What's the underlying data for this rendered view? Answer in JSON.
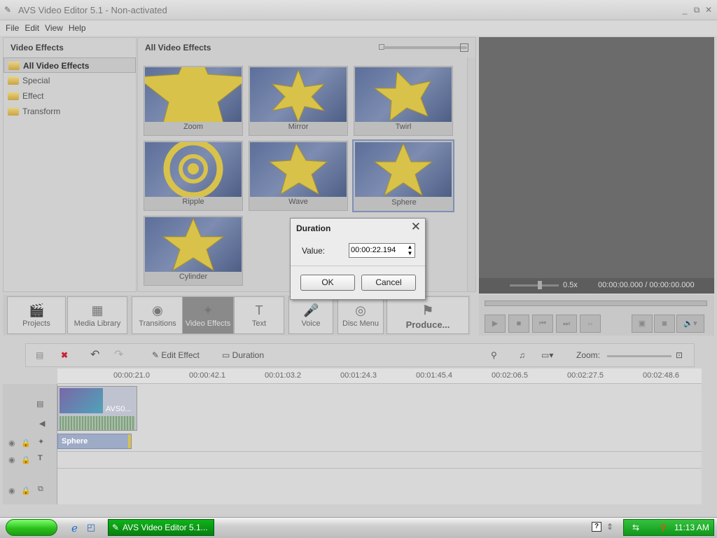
{
  "window": {
    "title": "AVS Video Editor 5.1 - Non-activated"
  },
  "menu": [
    "File",
    "Edit",
    "View",
    "Help"
  ],
  "sidebar": {
    "header": "Video Effects",
    "items": [
      {
        "label": "All Video Effects",
        "selected": true
      },
      {
        "label": "Special"
      },
      {
        "label": "Effect"
      },
      {
        "label": "Transform"
      }
    ]
  },
  "effects": {
    "header": "All Video Effects",
    "tiles": [
      {
        "label": "Zoom"
      },
      {
        "label": "Mirror"
      },
      {
        "label": "Twirl"
      },
      {
        "label": "Ripple"
      },
      {
        "label": "Wave"
      },
      {
        "label": "Sphere",
        "selected": true
      },
      {
        "label": "Cylinder"
      }
    ]
  },
  "preview": {
    "speed": "0.5x",
    "time": "00:00:00.000 / 00:00:00.000"
  },
  "tabs": [
    {
      "label": "Projects",
      "icon": "clapper-icon"
    },
    {
      "label": "Media Library",
      "icon": "film-icon"
    },
    {
      "label": "Transitions",
      "icon": "transition-icon"
    },
    {
      "label": "Video Effects",
      "icon": "star-wand-icon",
      "active": true
    },
    {
      "label": "Text",
      "icon": "text-t-icon"
    },
    {
      "label": "Voice",
      "icon": "microphone-icon"
    },
    {
      "label": "Disc Menu",
      "icon": "disc-icon"
    },
    {
      "label": "Produce...",
      "icon": "produce-icon"
    }
  ],
  "timeline_toolbar": {
    "edit_effect": "Edit Effect",
    "duration": "Duration",
    "zoom": "Zoom:"
  },
  "ruler": [
    "00:00:21.0",
    "00:00:42.1",
    "00:01:03.2",
    "00:01:24.3",
    "00:01:45.4",
    "00:02:06.5",
    "00:02:27.5",
    "00:02:48.6"
  ],
  "clips": {
    "video_label": "AVS0...",
    "effect_label": "Sphere"
  },
  "dialog": {
    "title": "Duration",
    "value_label": "Value:",
    "value": "00:00:22.194",
    "ok": "OK",
    "cancel": "Cancel"
  },
  "taskbar": {
    "task": "AVS Video Editor 5.1...",
    "clock": "11:13 AM"
  }
}
